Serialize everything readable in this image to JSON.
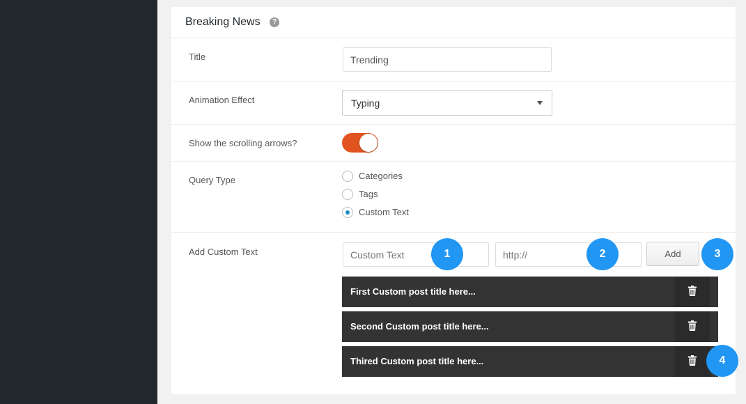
{
  "panel": {
    "title": "Breaking News",
    "help_glyph": "?"
  },
  "fields": {
    "title": {
      "label": "Title",
      "value": "Trending"
    },
    "animation": {
      "label": "Animation Effect",
      "selected": "Typing"
    },
    "arrows": {
      "label": "Show the scrolling arrows?",
      "enabled": true
    },
    "query_type": {
      "label": "Query Type",
      "options": [
        "Categories",
        "Tags",
        "Custom Text"
      ],
      "selected": "Custom Text"
    },
    "custom_text": {
      "label": "Add Custom Text",
      "text_placeholder": "Custom Text",
      "url_placeholder": "http://",
      "add_label": "Add"
    }
  },
  "items": [
    {
      "title": "First Custom post title here..."
    },
    {
      "title": "Second Custom post title here..."
    },
    {
      "title": "Thired Custom post title here..."
    }
  ],
  "badges": [
    "1",
    "2",
    "3",
    "4"
  ],
  "colors": {
    "sidebar": "#23282d",
    "toggle_on": "#e2541f",
    "badge": "#2196f3",
    "item_bg": "#333333",
    "radio_checked": "#1e8cbe"
  },
  "icons": {
    "help": "help-icon",
    "dropdown": "caret-down-icon",
    "delete": "trash-icon"
  }
}
